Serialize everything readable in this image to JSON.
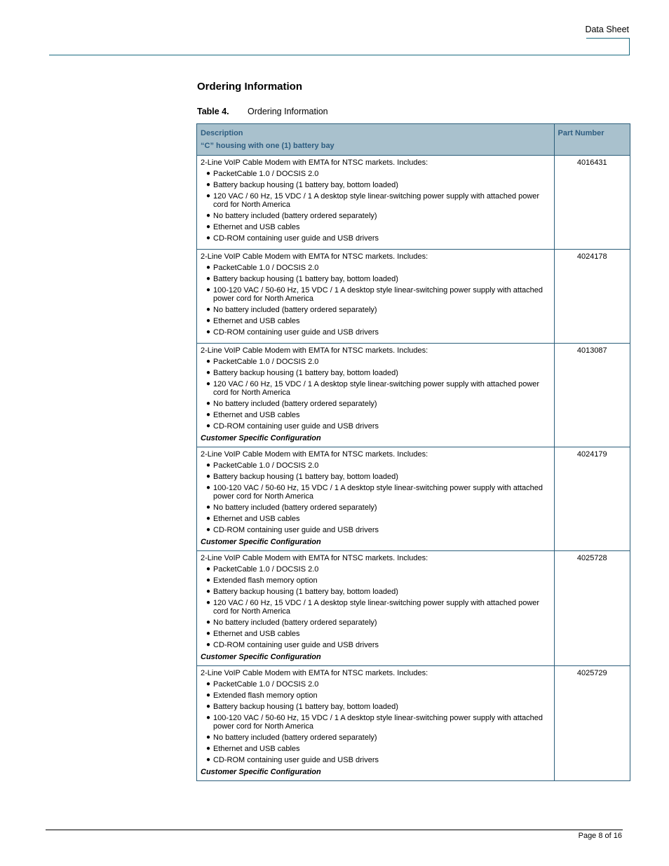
{
  "header": {
    "label": "Data Sheet"
  },
  "section": {
    "title": "Ordering Information"
  },
  "table": {
    "caption_number": "Table 4.",
    "caption_title": "Ordering Information",
    "columns": {
      "description": "Description",
      "description_sub": "“C” housing with one (1) battery bay",
      "part_number": "Part Number"
    },
    "bullet_glyph": "●",
    "rows": [
      {
        "intro": "2-Line VoIP Cable Modem with EMTA for NTSC markets. Includes:",
        "features": [
          "PacketCable 1.0 / DOCSIS 2.0",
          "Battery backup housing (1 battery bay, bottom loaded)",
          "120 VAC / 60 Hz, 15 VDC / 1 A desktop style linear-switching power supply with attached power cord for North America",
          "No battery included (battery ordered separately)",
          "Ethernet and USB cables",
          "CD-ROM containing user guide and USB drivers"
        ],
        "note": "",
        "part_number": "4016431"
      },
      {
        "intro": "2-Line VoIP Cable Modem with EMTA for NTSC markets. Includes:",
        "features": [
          "PacketCable 1.0 / DOCSIS 2.0",
          "Battery backup housing (1 battery bay, bottom loaded)",
          "100-120 VAC / 50-60 Hz, 15 VDC / 1 A desktop style linear-switching power supply with attached power cord for North America",
          "No battery included (battery ordered separately)",
          "Ethernet and USB cables",
          "CD-ROM containing user guide and USB drivers"
        ],
        "note": "",
        "part_number": "4024178"
      },
      {
        "intro": "2-Line VoIP Cable Modem with EMTA for NTSC markets. Includes:",
        "features": [
          "PacketCable 1.0 / DOCSIS 2.0",
          "Battery backup housing (1 battery bay, bottom loaded)",
          "120 VAC / 60 Hz, 15 VDC / 1 A desktop style linear-switching power supply with attached power cord for North America",
          "No battery included (battery ordered separately)",
          "Ethernet and USB cables",
          "CD-ROM containing user guide and USB drivers"
        ],
        "note": "Customer Specific Configuration",
        "part_number": "4013087"
      },
      {
        "intro": "2-Line VoIP Cable Modem with EMTA for NTSC markets. Includes:",
        "features": [
          "PacketCable 1.0 / DOCSIS 2.0",
          "Battery backup housing (1 battery bay, bottom loaded)",
          "100-120 VAC / 50-60 Hz, 15 VDC / 1 A desktop style linear-switching power supply with attached power cord for North America",
          "No battery included (battery ordered separately)",
          "Ethernet and USB cables",
          "CD-ROM containing user guide and USB drivers"
        ],
        "note": "Customer Specific Configuration",
        "part_number": "4024179"
      },
      {
        "intro": "2-Line VoIP Cable Modem with EMTA for NTSC markets. Includes:",
        "features": [
          "PacketCable 1.0 / DOCSIS 2.0",
          "Extended flash memory option",
          "Battery backup housing (1 battery bay, bottom loaded)",
          "120 VAC / 60 Hz, 15 VDC / 1 A desktop style linear-switching power supply with attached power cord for North America",
          "No battery included (battery ordered separately)",
          "Ethernet and USB cables",
          "CD-ROM containing user guide and USB drivers"
        ],
        "note": "Customer Specific Configuration",
        "part_number": "4025728"
      },
      {
        "intro": "2-Line VoIP Cable Modem with EMTA for NTSC markets. Includes:",
        "features": [
          "PacketCable 1.0 / DOCSIS 2.0",
          "Extended flash memory option",
          "Battery backup housing (1 battery bay, bottom loaded)",
          "100-120 VAC / 50-60 Hz, 15 VDC / 1 A desktop style linear-switching power supply with attached power cord for North America",
          "No battery included (battery ordered separately)",
          "Ethernet and USB cables",
          "CD-ROM containing user guide and USB drivers"
        ],
        "note": "Customer Specific Configuration",
        "part_number": "4025729"
      }
    ]
  },
  "footer": {
    "page": "Page 8 of 16"
  },
  "colors": {
    "accent_rule": "#1a6a80",
    "table_header_bg": "#a9c1cd",
    "table_header_text": "#2e5d80",
    "table_border": "#2b5d7a"
  }
}
